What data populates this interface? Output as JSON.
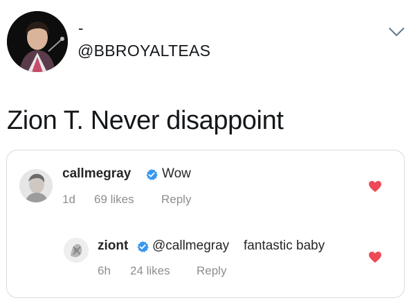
{
  "tweet": {
    "display_name": "-",
    "handle": "@BBROYALTEAS",
    "text": "Zion T. Never disappoint"
  },
  "comments": [
    {
      "username": "callmegray",
      "text": "Wow",
      "time": "1d",
      "likes": "69 likes",
      "reply_label": "Reply"
    },
    {
      "username": "ziont",
      "mention": "@callmegray",
      "text": "fantastic baby",
      "time": "6h",
      "likes": "24 likes",
      "reply_label": "Reply"
    }
  ],
  "icons": {
    "chevron": "chevron-down-icon",
    "verified": "verified-badge-icon",
    "like": "heart-icon"
  },
  "colors": {
    "heart": "#ed4956",
    "verified": "#3897f0",
    "mention": "#262626",
    "meta": "#8e8e8e"
  }
}
